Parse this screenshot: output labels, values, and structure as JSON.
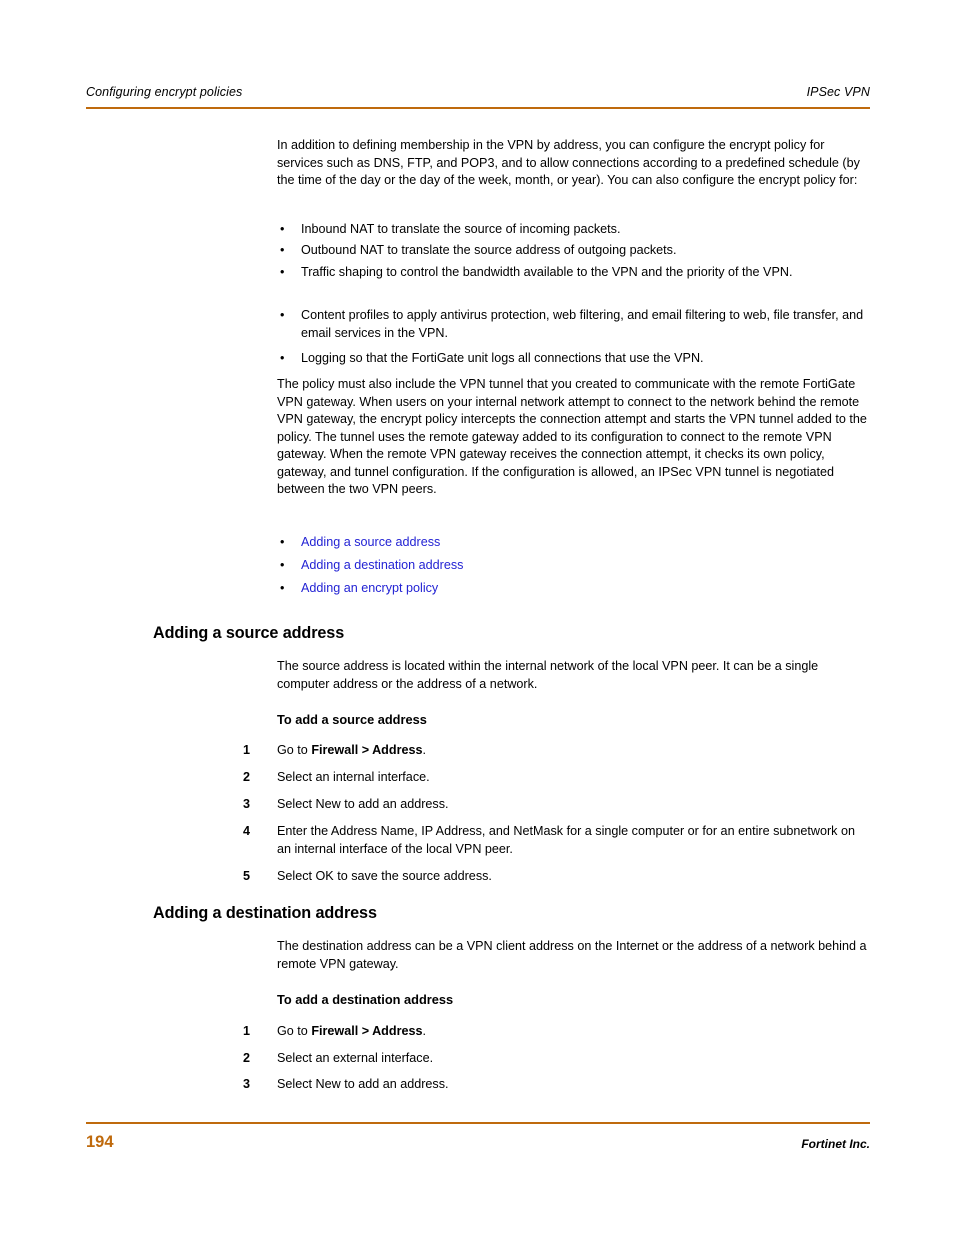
{
  "header": {
    "left_title": "Configuring encrypt policies",
    "right_title": "IPSec VPN",
    "rule_color": "#bf6a0d"
  },
  "intro": {
    "paragraph": "In addition to defining membership in the VPN by address, you can configure the encrypt policy for services such as DNS, FTP, and POP3, and to allow connections according to a predefined schedule (by the time of the day or the day of the week, month, or year). You can also configure the encrypt policy for:",
    "bullets": [
      "Inbound NAT to translate the source of incoming packets.",
      "Outbound NAT to translate the source address of outgoing packets.",
      "Traffic shaping to control the bandwidth available to the VPN and the priority of the VPN.",
      "Content profiles to apply antivirus protection, web filtering, and email filtering to web, file transfer, and email services in the VPN.",
      "Logging so that the FortiGate unit logs all connections that use the VPN."
    ],
    "paragraph2": "The policy must also include the VPN tunnel that you created to communicate with the remote FortiGate VPN gateway. When users on your internal network attempt to connect to the network behind the remote VPN gateway, the encrypt policy intercepts the connection attempt and starts the VPN tunnel added to the policy. The tunnel uses the remote gateway added to its configuration to connect to the remote VPN gateway. When the remote VPN gateway receives the connection attempt, it checks its own policy, gateway, and tunnel configuration. If the configuration is allowed, an IPSec VPN tunnel is negotiated between the two VPN peers.",
    "link_color": "#2323d4",
    "links": [
      "Adding a source address",
      "Adding a destination address",
      "Adding an encrypt policy"
    ]
  },
  "section_source": {
    "heading": "Adding a source address",
    "paragraph": "The source address is located within the internal network of the local VPN peer. It can be a single computer address or the address of a network.",
    "subheading": "To add a source address",
    "steps": [
      {
        "num": "1",
        "pre": "Go to ",
        "bold": "Firewall > Address",
        "post": "."
      },
      {
        "num": "2",
        "pre": "Select an internal interface.",
        "bold": "",
        "post": ""
      },
      {
        "num": "3",
        "pre": "Select New to add an address.",
        "bold": "",
        "post": ""
      },
      {
        "num": "4",
        "pre": "Enter the Address Name, IP Address, and NetMask for a single computer or for an entire subnetwork on an internal interface of the local VPN peer.",
        "bold": "",
        "post": ""
      },
      {
        "num": "5",
        "pre": "Select OK to save the source address.",
        "bold": "",
        "post": ""
      }
    ]
  },
  "section_destination": {
    "heading": "Adding a destination address",
    "paragraph": "The destination address can be a VPN client address on the Internet or the address of a network behind a remote VPN gateway.",
    "subheading": "To add a destination address",
    "steps": [
      {
        "num": "1",
        "pre": "Go to ",
        "bold": "Firewall > Address",
        "post": "."
      },
      {
        "num": "2",
        "pre": "Select an external interface.",
        "bold": "",
        "post": ""
      },
      {
        "num": "3",
        "pre": "Select New to add an address.",
        "bold": "",
        "post": ""
      }
    ]
  },
  "footer": {
    "page_number": "194",
    "publisher": "Fortinet Inc.",
    "rule_color": "#bf6a0d",
    "page_number_color": "#bf6a0d"
  }
}
